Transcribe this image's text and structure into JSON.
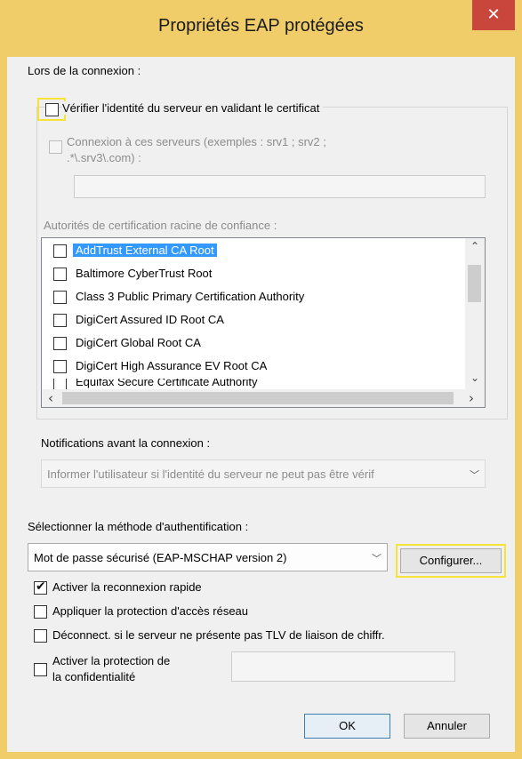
{
  "window": {
    "title": "Propriétés EAP protégées",
    "close_glyph": "✕"
  },
  "connection": {
    "heading": "Lors de la connexion :",
    "verify_server_label": "Vérifier l'identité du serveur en validant le certificat",
    "verify_server_checked": false,
    "connect_servers_label_line1": "Connexion à ces serveurs (exemples : srv1 ; srv2 ;",
    "connect_servers_label_line2": ".*\\.srv3\\.com) :",
    "servers_value": "",
    "ca_heading": "Autorités de certification racine de confiance :",
    "ca_list": [
      {
        "label": "AddTrust External CA Root",
        "checked": false,
        "selected": true
      },
      {
        "label": "Baltimore CyberTrust Root",
        "checked": false
      },
      {
        "label": "Class 3 Public Primary Certification Authority",
        "checked": false
      },
      {
        "label": "DigiCert Assured ID Root CA",
        "checked": false
      },
      {
        "label": "DigiCert Global Root CA",
        "checked": false
      },
      {
        "label": "DigiCert High Assurance EV Root CA",
        "checked": false
      },
      {
        "label": "Equifax Secure Certificate Authority",
        "checked": false
      }
    ],
    "notifications_heading": "Notifications avant la connexion :",
    "notifications_value": "Informer l'utilisateur si l'identité du serveur ne peut pas être vérif"
  },
  "auth": {
    "heading": "Sélectionner la méthode d'authentification :",
    "method_value": "Mot de passe sécurisé (EAP-MSCHAP version 2)",
    "configure_label": "Configurer..."
  },
  "options": {
    "fast_reconnect_label": "Activer la reconnexion rapide",
    "fast_reconnect_checked": true,
    "nap_label": "Appliquer la protection d'accès réseau",
    "nap_checked": false,
    "disconnect_label": "Déconnect. si le serveur ne présente pas TLV de liaison de chiffr.",
    "disconnect_checked": false,
    "privacy_label_line1": "Activer la protection de",
    "privacy_label_line2": "la confidentialité",
    "privacy_checked": false,
    "privacy_value": ""
  },
  "buttons": {
    "ok": "OK",
    "cancel": "Annuler"
  },
  "icons": {
    "check": "✔",
    "chevron_down": "﹀",
    "arrow_up": "⌃",
    "arrow_down": "⌄",
    "arrow_left": "‹",
    "arrow_right": "›"
  },
  "colors": {
    "frame": "#f1cd6a",
    "close": "#c9463d",
    "selection": "#3399ff",
    "highlight": "#f5e33a"
  }
}
